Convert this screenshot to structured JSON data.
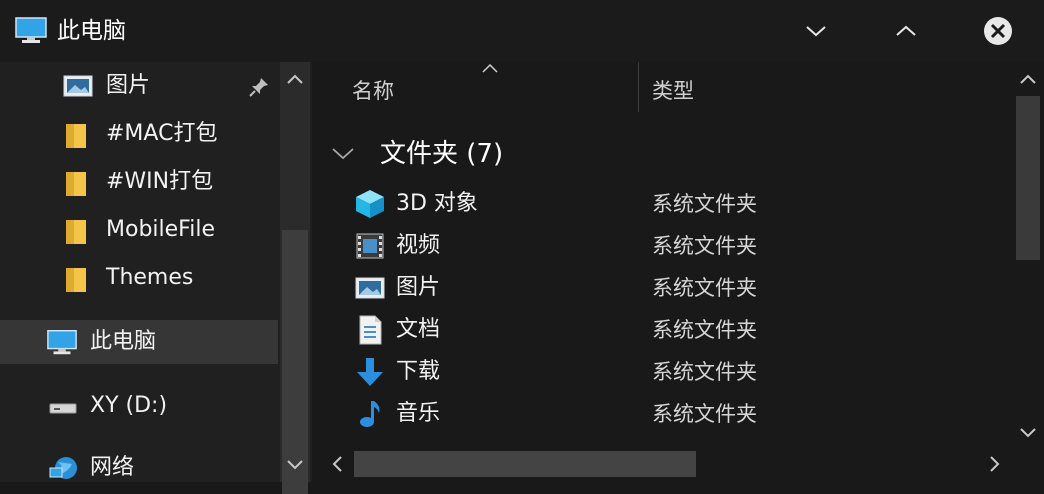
{
  "window": {
    "title": "此电脑",
    "icon": "this-pc-icon",
    "controls": [
      "chevron-down-icon",
      "chevron-up-icon",
      "close-icon"
    ]
  },
  "nav": {
    "items": [
      {
        "label": "图片",
        "icon": "pictures-icon",
        "pinned": true
      },
      {
        "label": "#MAC打包",
        "icon": "folder-icon"
      },
      {
        "label": "#WIN打包",
        "icon": "folder-icon"
      },
      {
        "label": "MobileFile",
        "icon": "folder-icon"
      },
      {
        "label": "Themes",
        "icon": "folder-icon"
      },
      {
        "label": "此电脑",
        "icon": "this-pc-icon",
        "selected": true
      },
      {
        "label": "XY (D:)",
        "icon": "drive-icon"
      },
      {
        "label": "网络",
        "icon": "network-icon"
      }
    ]
  },
  "columns": {
    "name": "名称",
    "type": "类型"
  },
  "group": {
    "title": "文件夹 (7)"
  },
  "files": [
    {
      "name": "3D 对象",
      "type": "系统文件夹",
      "icon": "3d-objects-icon"
    },
    {
      "name": "视频",
      "type": "系统文件夹",
      "icon": "videos-icon"
    },
    {
      "name": "图片",
      "type": "系统文件夹",
      "icon": "pictures-icon"
    },
    {
      "name": "文档",
      "type": "系统文件夹",
      "icon": "documents-icon"
    },
    {
      "name": "下载",
      "type": "系统文件夹",
      "icon": "downloads-icon"
    },
    {
      "name": "音乐",
      "type": "系统文件夹",
      "icon": "music-icon"
    }
  ],
  "colors": {
    "accent": "#1e90e6",
    "folder": "#f3c548",
    "background": "#191919",
    "nav_background": "#202020",
    "selected": "#363636"
  }
}
